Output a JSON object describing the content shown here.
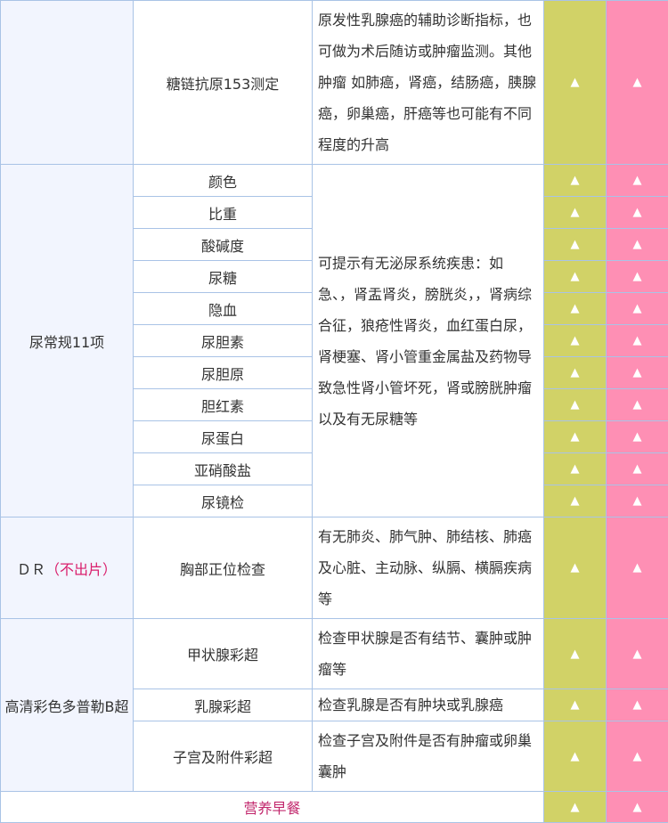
{
  "rows": {
    "tumor": {
      "item": "糖链抗原153测定",
      "desc": "原发性乳腺癌的辅助诊断指标，也可做为术后随访或肿瘤监测。其他肿瘤 如肺癌，肾癌，结肠癌，胰腺癌，卵巢癌，肝癌等也可能有不同程度的升高"
    },
    "urine": {
      "category": "尿常规11项",
      "items": [
        "颜色",
        "比重",
        "酸碱度",
        "尿糖",
        "隐血",
        "尿胆素",
        "尿胆原",
        "胆红素",
        "尿蛋白",
        "亚硝酸盐",
        "尿镜检"
      ],
      "desc": "可提示有无泌尿系统疾患：如急、，肾盂肾炎，膀胱炎，，肾病综合征，狼疮性肾炎，血红蛋白尿，肾梗塞、肾小管重金属盐及药物导致急性肾小管坏死，肾或膀胱肿瘤以及有无尿糖等"
    },
    "dr": {
      "category": "ＤＲ",
      "category_note": "（不出片）",
      "item": "胸部正位检查",
      "desc": "有无肺炎、肺气肿、肺结核、肺癌及心脏、主动脉、纵膈、横膈疾病等"
    },
    "bultrasound": {
      "category": "高清彩色多普勒B超",
      "items": [
        {
          "item": "甲状腺彩超",
          "desc": "检查甲状腺是否有结节、囊肿或肿瘤等"
        },
        {
          "item": "乳腺彩超",
          "desc": "检查乳腺是否有肿块或乳腺癌"
        },
        {
          "item": "子宫及附件彩超",
          "desc": "检查子宫及附件是否有肿瘤或卵巢囊肿"
        }
      ]
    },
    "breakfast": {
      "label": "营养早餐"
    }
  },
  "mark": "▲",
  "colors": {
    "column_green": "#d1d267",
    "column_pink": "#fe8fb4",
    "border": "#a9c3e6",
    "category_bg": "#f2f5fe",
    "accent_text": "#d91e6c"
  }
}
